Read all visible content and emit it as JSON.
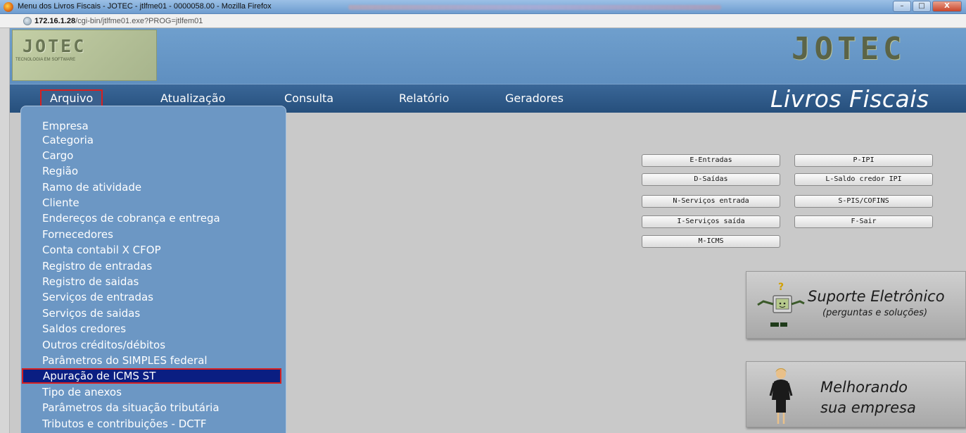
{
  "window": {
    "title": "Menu dos Livros Fiscais - JOTEC - jtlfme01 - 0000058.00 - Mozilla Firefox",
    "controls": [
      "–",
      "□",
      "X"
    ]
  },
  "address": {
    "host": "172.16.1.28",
    "path": "/cgi-bin/jtlfme01.exe?PROG=jtlfem01"
  },
  "header": {
    "logo_text": "JOTEC",
    "logo_subtitle": "TECNOLOGIA EM SOFTWARE",
    "brand": "JOTEC",
    "page_title": "Livros Fiscais"
  },
  "menu": [
    {
      "label": "Arquivo",
      "active": true
    },
    {
      "label": "Atualização",
      "active": false
    },
    {
      "label": "Consulta",
      "active": false
    },
    {
      "label": "Relatório",
      "active": false
    },
    {
      "label": "Geradores",
      "active": false
    }
  ],
  "dropdown": {
    "items": [
      "Empresa",
      "Categoria",
      "Cargo",
      "Região",
      "Ramo de atividade",
      "Cliente",
      "Endereços de cobrança e entrega",
      "Fornecedores",
      "Conta contabil X CFOP",
      "Registro de entradas",
      "Registro de saidas",
      "Serviços de entradas",
      "Serviços de saidas",
      "Saldos credores",
      "Outros créditos/débitos",
      "Parâmetros do SIMPLES federal",
      "Apuração de ICMS ST",
      "Tipo de anexos",
      "Parâmetros da situação tributária",
      "Tributos e contribuições - DCTF"
    ],
    "selected": "Apuração de ICMS ST"
  },
  "buttons": {
    "left": [
      "E-Entradas",
      "D-Saídas",
      "N-Serviços entrada",
      "I-Serviços saída",
      "M-ICMS"
    ],
    "right": [
      "P-IPI",
      "L-Saldo credor IPI",
      "S-PIS/COFINS",
      "F-Sair"
    ]
  },
  "promos": {
    "support": {
      "title": "Suporte Eletrônico",
      "subtitle": "(perguntas e soluções)"
    },
    "improve": {
      "line1": "Melhorando",
      "line2": "sua empresa"
    }
  },
  "colors": {
    "header_blue": "#6f9fcd",
    "menubar_blue": "#2d5a89",
    "dropdown_blue": "#6c97c4",
    "selected_bg": "#0a1e82",
    "highlight_red": "#d82020"
  }
}
